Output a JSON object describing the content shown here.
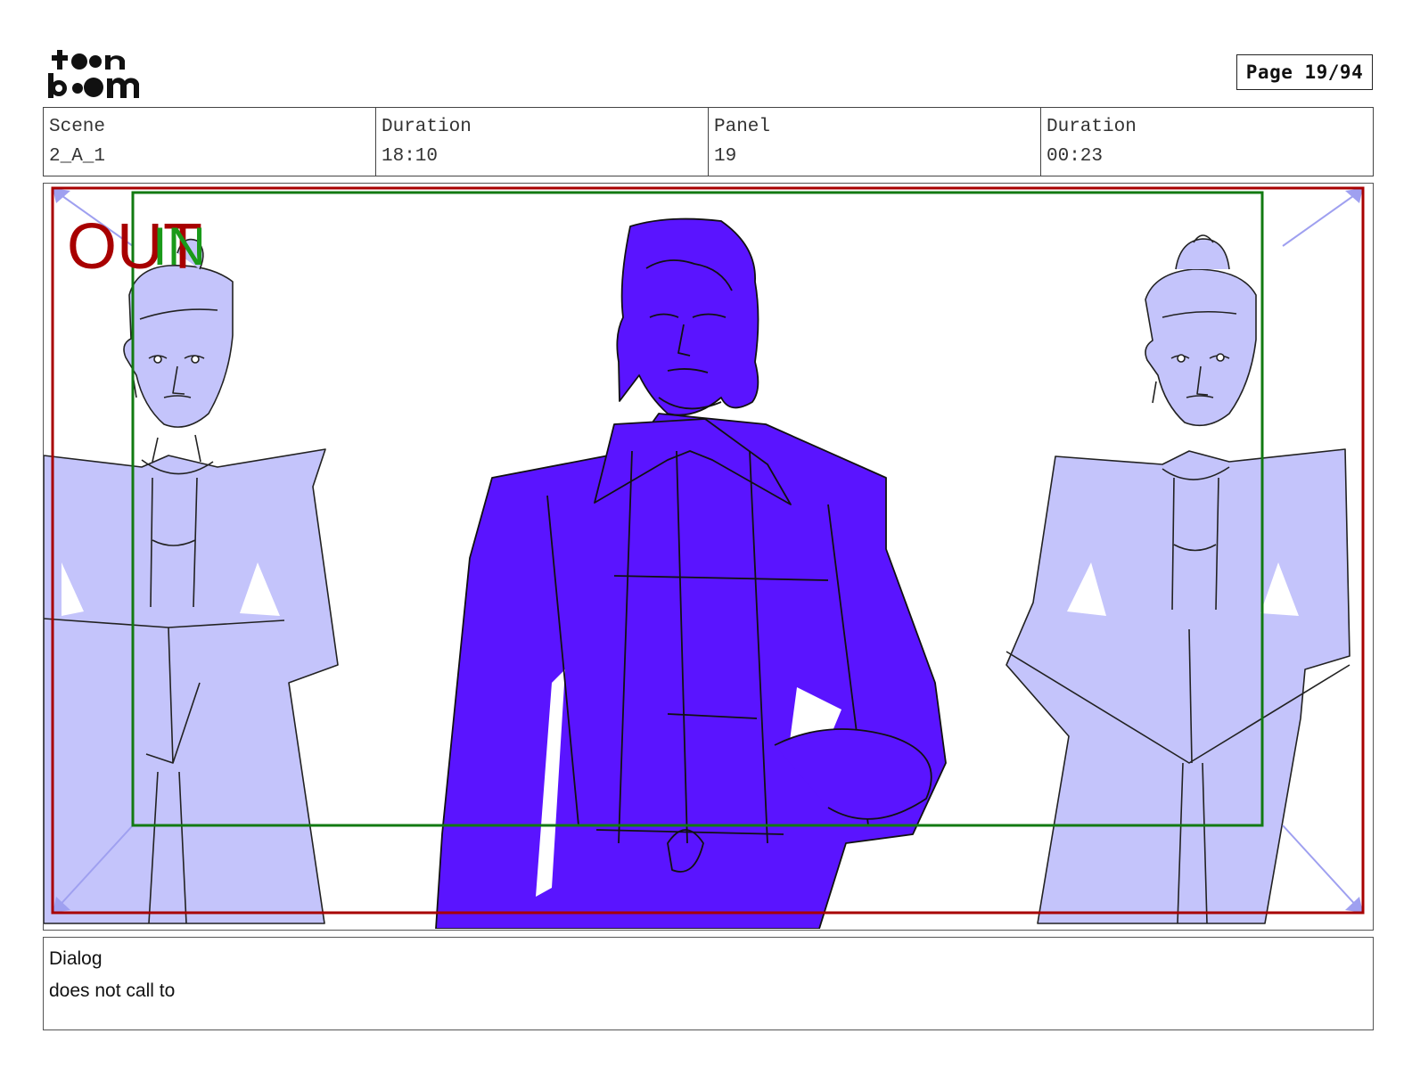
{
  "logo": {
    "alt": "toon boom"
  },
  "page_label": "Page 19/94",
  "info": {
    "scene_label": "Scene",
    "scene_value": "2_A_1",
    "duration_label": "Duration",
    "duration_value": "18:10",
    "panel_label": "Panel",
    "panel_value": "19",
    "panel_duration_label": "Duration",
    "panel_duration_value": "00:23"
  },
  "frame": {
    "out_label": "OUT",
    "in_label": "IN",
    "colors": {
      "out": "#a80000",
      "in": "#1a9a1a",
      "lead": "#5a14ff",
      "side": "#c4c4fb"
    }
  },
  "dialog": {
    "label": "Dialog",
    "text": "does not call to"
  }
}
